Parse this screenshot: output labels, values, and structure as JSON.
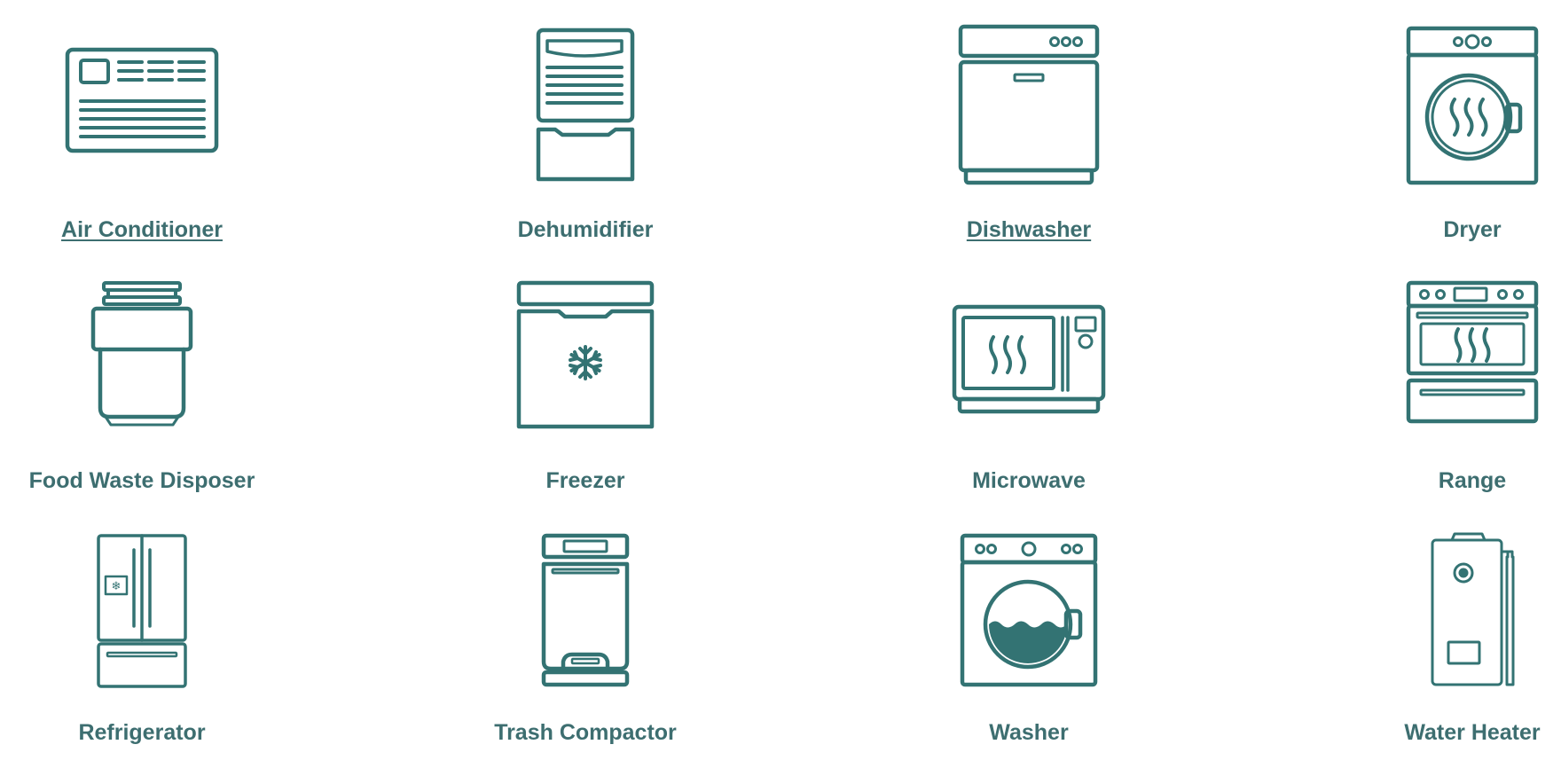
{
  "accent_color": "#337373",
  "label_color": "#3d6e70",
  "appliances": [
    {
      "label": "Air Conditioner",
      "icon": "air-conditioner-icon",
      "link": true
    },
    {
      "label": "Dehumidifier",
      "icon": "dehumidifier-icon",
      "link": false
    },
    {
      "label": "Dishwasher",
      "icon": "dishwasher-icon",
      "link": true
    },
    {
      "label": "Dryer",
      "icon": "dryer-icon",
      "link": false
    },
    {
      "label": "Food Waste Disposer",
      "icon": "food-waste-disposer-icon",
      "link": false
    },
    {
      "label": "Freezer",
      "icon": "freezer-icon",
      "link": false
    },
    {
      "label": "Microwave",
      "icon": "microwave-icon",
      "link": false
    },
    {
      "label": "Range",
      "icon": "range-icon",
      "link": false
    },
    {
      "label": "Refrigerator",
      "icon": "refrigerator-icon",
      "link": false
    },
    {
      "label": "Trash Compactor",
      "icon": "trash-compactor-icon",
      "link": false
    },
    {
      "label": "Washer",
      "icon": "washer-icon",
      "link": false
    },
    {
      "label": "Water Heater",
      "icon": "water-heater-icon",
      "link": false
    }
  ]
}
